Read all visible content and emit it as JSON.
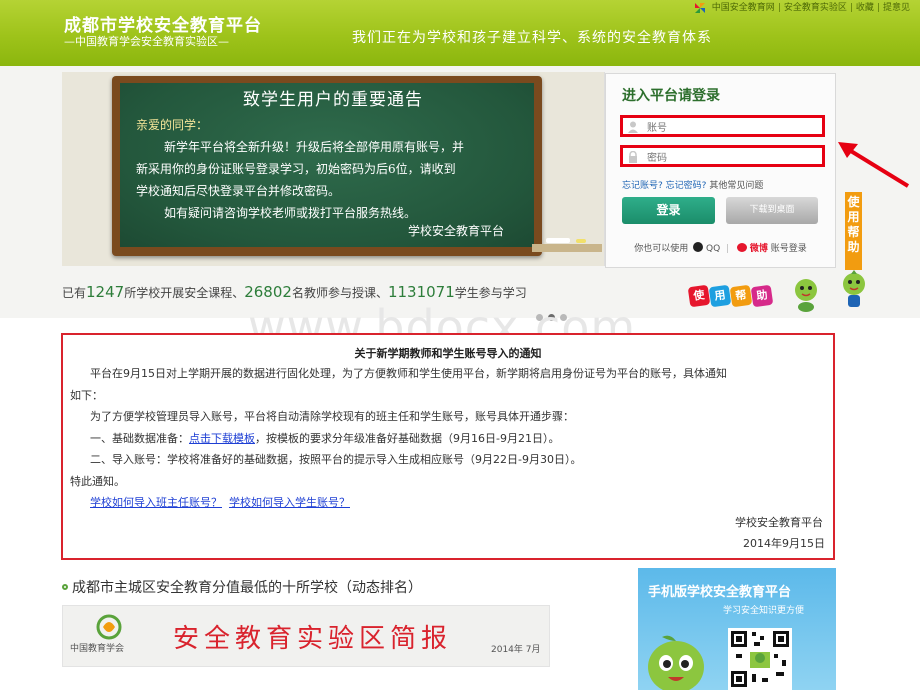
{
  "header": {
    "title": "成都市学校安全教育平台",
    "subtitle": "—中国教育学会安全教育实验区—",
    "slogan": "我们正在为学校和孩子建立科学、系统的安全教育体系",
    "links": [
      "中国安全教育网",
      "安全教育实验区",
      "收藏",
      "提意见"
    ],
    "colors": {
      "bar": "#9ec31a"
    }
  },
  "announcement": {
    "title": "致学生用户的重要通告",
    "greeting": "亲爱的同学：",
    "lines": [
      "新学年平台将全新升级！升级后将全部停用原有账号，并",
      "新采用你的身份证账号登录学习，初始密码为后6位，请收到",
      "学校通知后尽快登录平台并修改密码。",
      "如有疑问请咨询学校老师或拨打平台服务热线。"
    ],
    "signature": "学校安全教育平台"
  },
  "login": {
    "title": "进入平台请登录",
    "username_placeholder": "账号",
    "password_placeholder": "密码",
    "forgot_account": "忘记账号?",
    "forgot_password": "忘记密码?",
    "other_issues": "其他常见问题",
    "login_button": "登录",
    "download_button": "下载到桌面",
    "alt_prefix": "你也可以使用",
    "alt_qq": "QQ",
    "alt_weibo": "微博",
    "alt_suffix": "账号登录",
    "icons": [
      "user-icon",
      "lock-icon",
      "qq-icon",
      "weibo-icon"
    ]
  },
  "help": {
    "tab": "使用帮助",
    "badge": [
      "使",
      "用",
      "帮",
      "助"
    ]
  },
  "stats": {
    "pre": "已有",
    "schools": "1247",
    "schools_text": "所学校开展安全课程、",
    "teachers": "26802",
    "teachers_text": "名教师参与授课、",
    "students": "1131071",
    "students_text": "学生参与学习"
  },
  "watermark": "www.bdocx.com",
  "notice": {
    "title": "关于新学期教师和学生账号导入的通知",
    "p1a": "平台在9月15日对上学期开展的数据进行固化处理，为了方便教师和学生使用平台，新学期将启用身份证号为平台的账号，具体通知",
    "p1b": "如下：",
    "p2": "为了方便学校管理员导入账号，平台将自动清除学校现有的班主任和学生账号，账号具体开通步骤：",
    "step1_pre": "一、基础数据准备：",
    "step1_link": "点击下载模板",
    "step1_post": "，按模板的要求分年级准备好基础数据（9月16日-9月21日）。",
    "step2": "二、导入账号：学校将准备好的基础数据，按照平台的提示导入生成相应账号（9月22日-9月30日）。",
    "closing": "特此通知。",
    "link1": "学校如何导入班主任账号？",
    "link2": "学校如何导入学生账号？",
    "signature": "学校安全教育平台",
    "date": "2014年9月15日"
  },
  "ranking": {
    "title": "成都市主城区安全教育分值最低的十所学校（动态排名）"
  },
  "bulletin": {
    "logo_text": "中国教育学会",
    "title": "安全教育实验区简报",
    "date": "2014年 7月"
  },
  "mobile": {
    "title": "手机版学校安全教育平台",
    "subtitle": "学习安全知识更方便"
  }
}
